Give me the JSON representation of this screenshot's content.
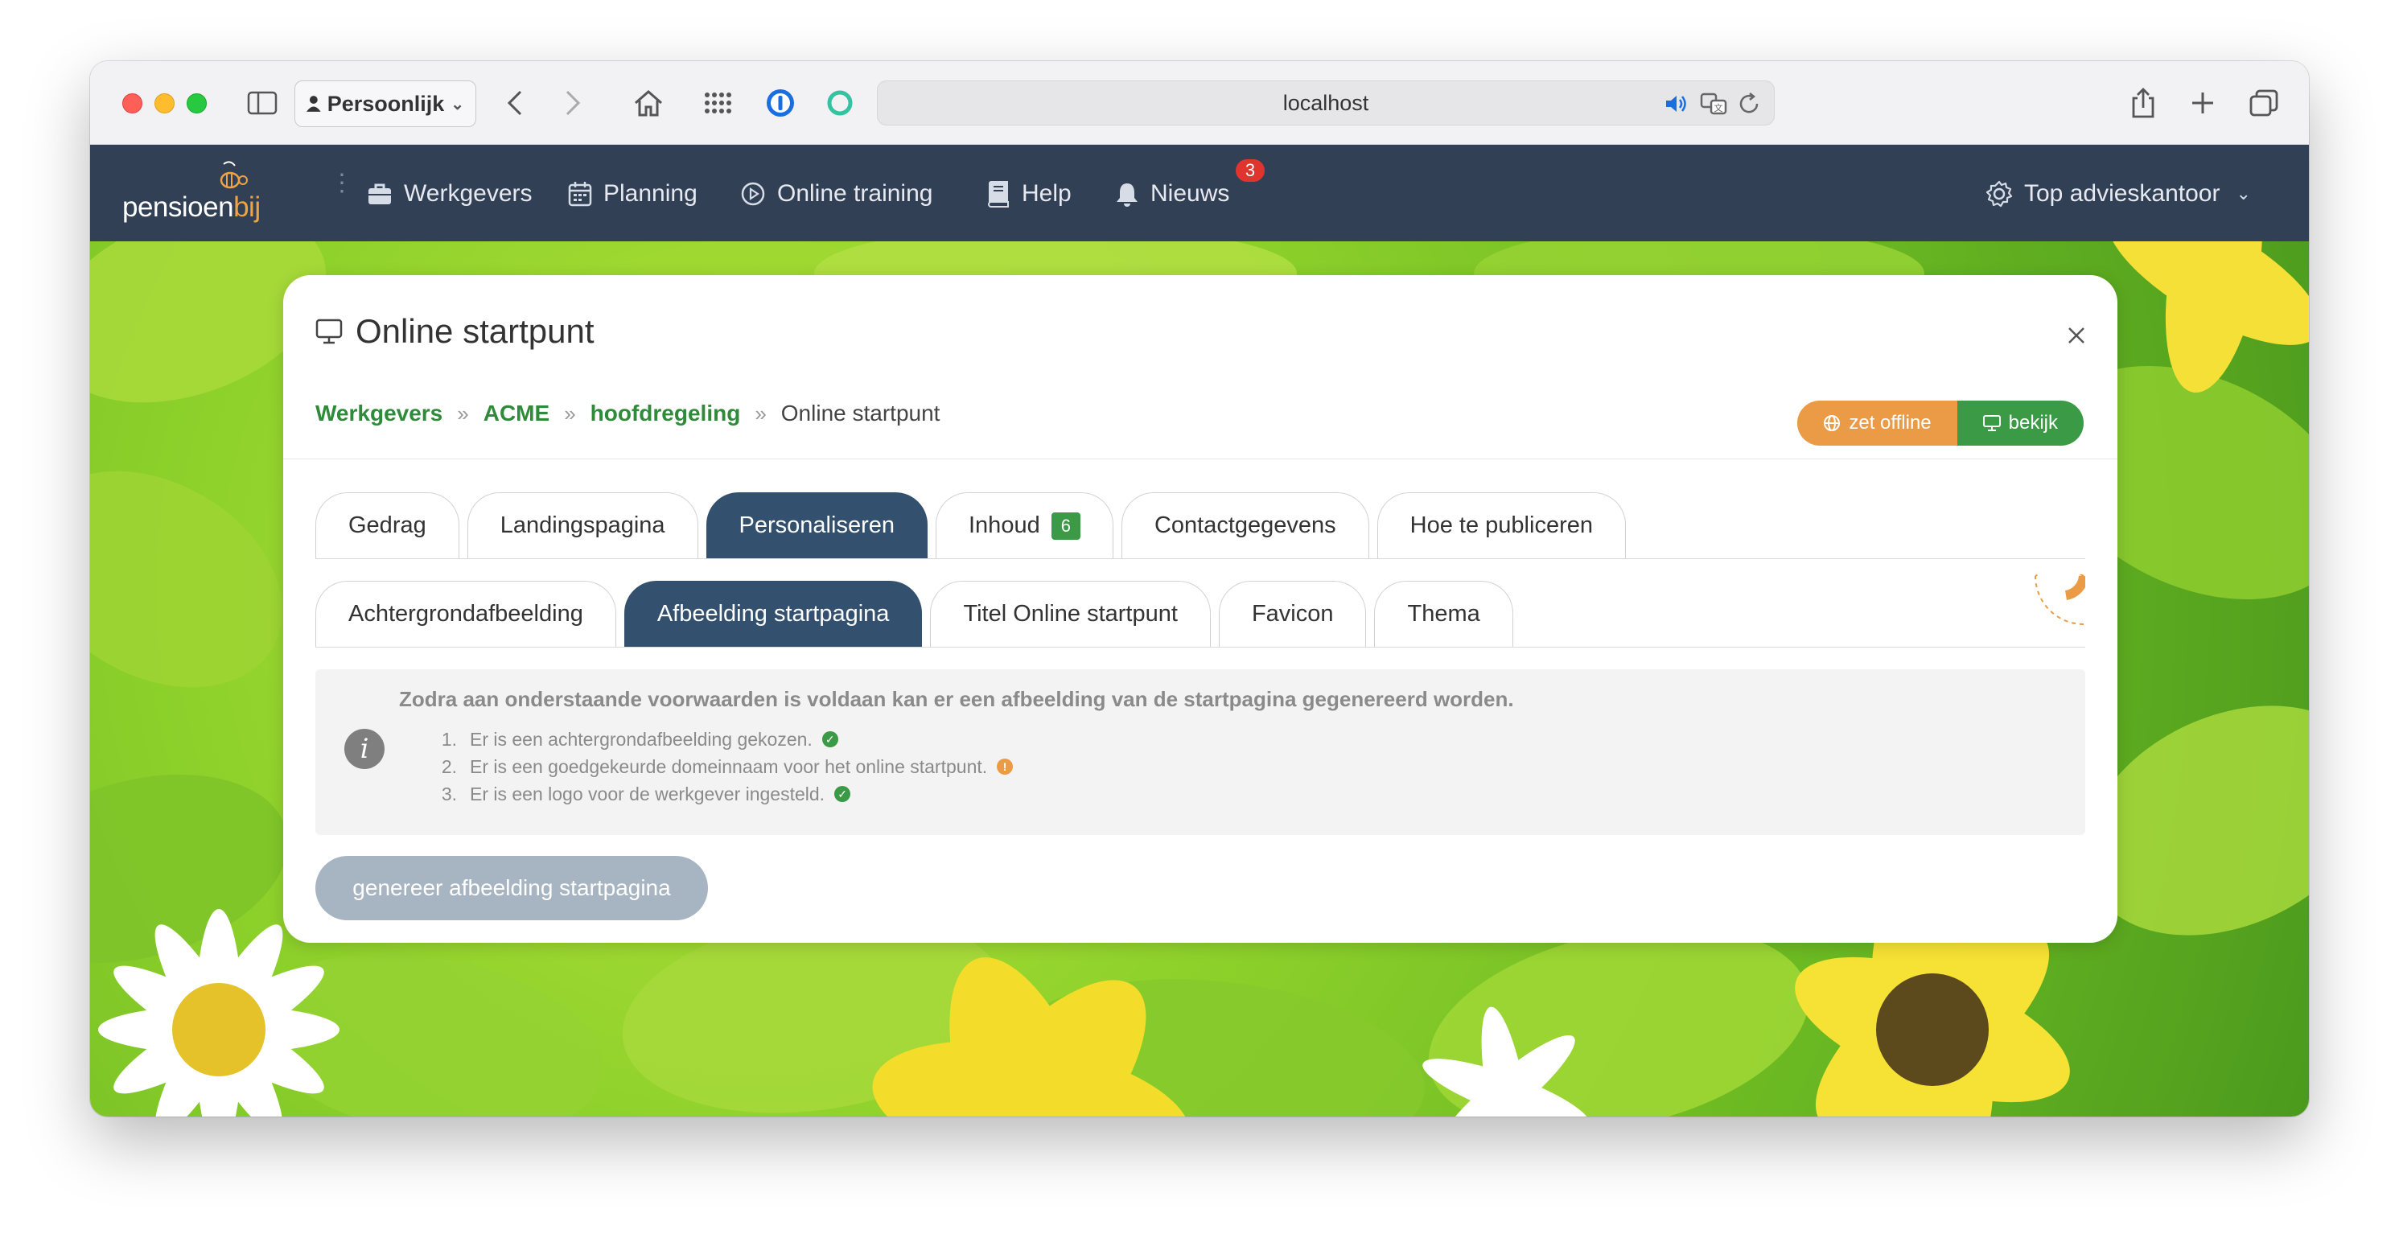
{
  "browser": {
    "profile_label": "Persoonlijk",
    "url": "localhost"
  },
  "nav": {
    "logo": {
      "part1": "pensioen",
      "part2": "bij"
    },
    "items": [
      {
        "label": "Werkgevers",
        "icon": "briefcase-icon"
      },
      {
        "label": "Planning",
        "icon": "calendar-icon"
      },
      {
        "label": "Online training",
        "icon": "play-circle-icon"
      },
      {
        "label": "Help",
        "icon": "book-icon"
      },
      {
        "label": "Nieuws",
        "icon": "bell-icon"
      }
    ],
    "news_badge": "3",
    "org_label": "Top advieskantoor"
  },
  "modal": {
    "title": "Online startpunt",
    "breadcrumbs": [
      "Werkgevers",
      "ACME",
      "hoofdregeling"
    ],
    "breadcrumb_current": "Online startpunt",
    "btn_offline": "zet offline",
    "btn_view": "bekijk",
    "tabs": [
      {
        "label": "Gedrag",
        "active": false
      },
      {
        "label": "Landingspagina",
        "active": false
      },
      {
        "label": "Personaliseren",
        "active": true
      },
      {
        "label": "Inhoud",
        "active": false,
        "count": "6"
      },
      {
        "label": "Contactgegevens",
        "active": false
      },
      {
        "label": "Hoe te publiceren",
        "active": false
      }
    ],
    "subtabs": [
      {
        "label": "Achtergrondafbeelding",
        "active": false
      },
      {
        "label": "Afbeelding startpagina",
        "active": true
      },
      {
        "label": "Titel Online startpunt",
        "active": false
      },
      {
        "label": "Favicon",
        "active": false
      },
      {
        "label": "Thema",
        "active": false
      }
    ],
    "info": {
      "title": "Zodra aan onderstaande voorwaarden is voldaan kan er een afbeelding van de startpagina gegenereerd worden.",
      "conditions": [
        {
          "num": "1.",
          "text": "Er is een achtergrondafbeelding gekozen.",
          "status": "ok"
        },
        {
          "num": "2.",
          "text": "Er is een goedgekeurde domeinnaam voor het online startpunt.",
          "status": "warning"
        },
        {
          "num": "3.",
          "text": "Er is een logo voor de werkgever ingesteld.",
          "status": "ok"
        }
      ]
    },
    "generate_button": "genereer afbeelding startpagina"
  },
  "colors": {
    "navbar": "#324055",
    "active_tab": "#33506e",
    "link_green": "#2f8a3a",
    "accent_orange": "#eb9b45",
    "accent_green": "#3a9a45",
    "disabled_button": "#a7b4c1"
  }
}
